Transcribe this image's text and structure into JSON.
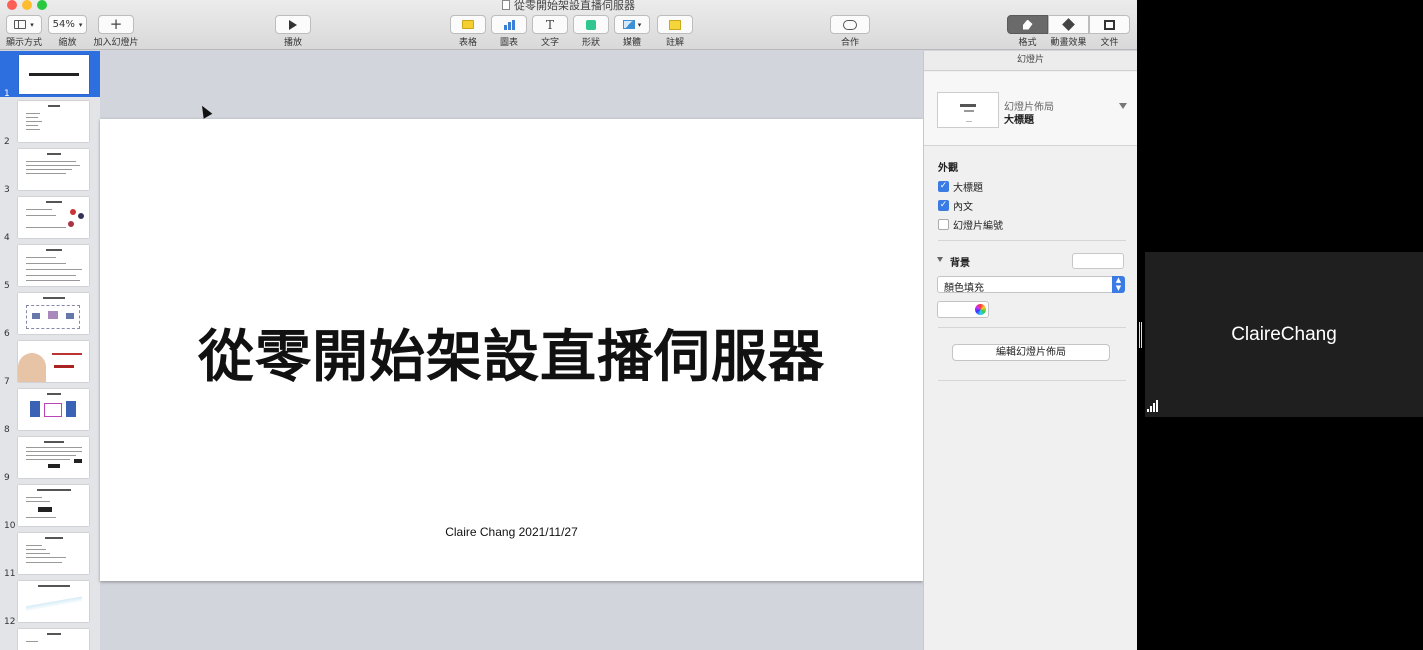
{
  "window": {
    "title": "從零開始架設直播伺服器"
  },
  "toolbar": {
    "view_label": "顯示方式",
    "zoom_value": "54%",
    "zoom_label": "縮放",
    "add_slide_label": "加入幻燈片",
    "play_label": "播放",
    "table_label": "表格",
    "chart_label": "圖表",
    "text_label": "文字",
    "shape_label": "形狀",
    "media_label": "媒體",
    "comment_label": "註解",
    "collaborate_label": "合作",
    "format_label": "格式",
    "animate_label": "動畫效果",
    "document_label": "文件"
  },
  "navigator": {
    "slides": [
      "1",
      "2",
      "3",
      "4",
      "5",
      "6",
      "7",
      "8",
      "9",
      "10",
      "11",
      "12"
    ],
    "selected": "1"
  },
  "slide": {
    "title": "從零開始架設直播伺服器",
    "subtitle": "Claire Chang 2021/11/27"
  },
  "inspector": {
    "header": "幻燈片",
    "layout_label": "幻燈片佈局",
    "layout_value": "大標題",
    "appearance_title": "外觀",
    "checkboxes": [
      {
        "label": "大標題",
        "checked": true
      },
      {
        "label": "內文",
        "checked": true
      },
      {
        "label": "幻燈片編號",
        "checked": false
      }
    ],
    "background_title": "背景",
    "fill_option": "顏色填充",
    "edit_layout_button": "編輯幻燈片佈局"
  },
  "participant": {
    "name": "ClaireChang"
  },
  "colors": {
    "accent": "#3b7ce4",
    "selection": "#2e6fe0",
    "canvas_bg": "#d2d5dc",
    "table_icon": "#f4cf2f",
    "chart_icon": "#3c7fd6",
    "shape_icon": "#2fc78f",
    "media_icon": "#3f8fd6",
    "comment_icon": "#f4d53a"
  }
}
